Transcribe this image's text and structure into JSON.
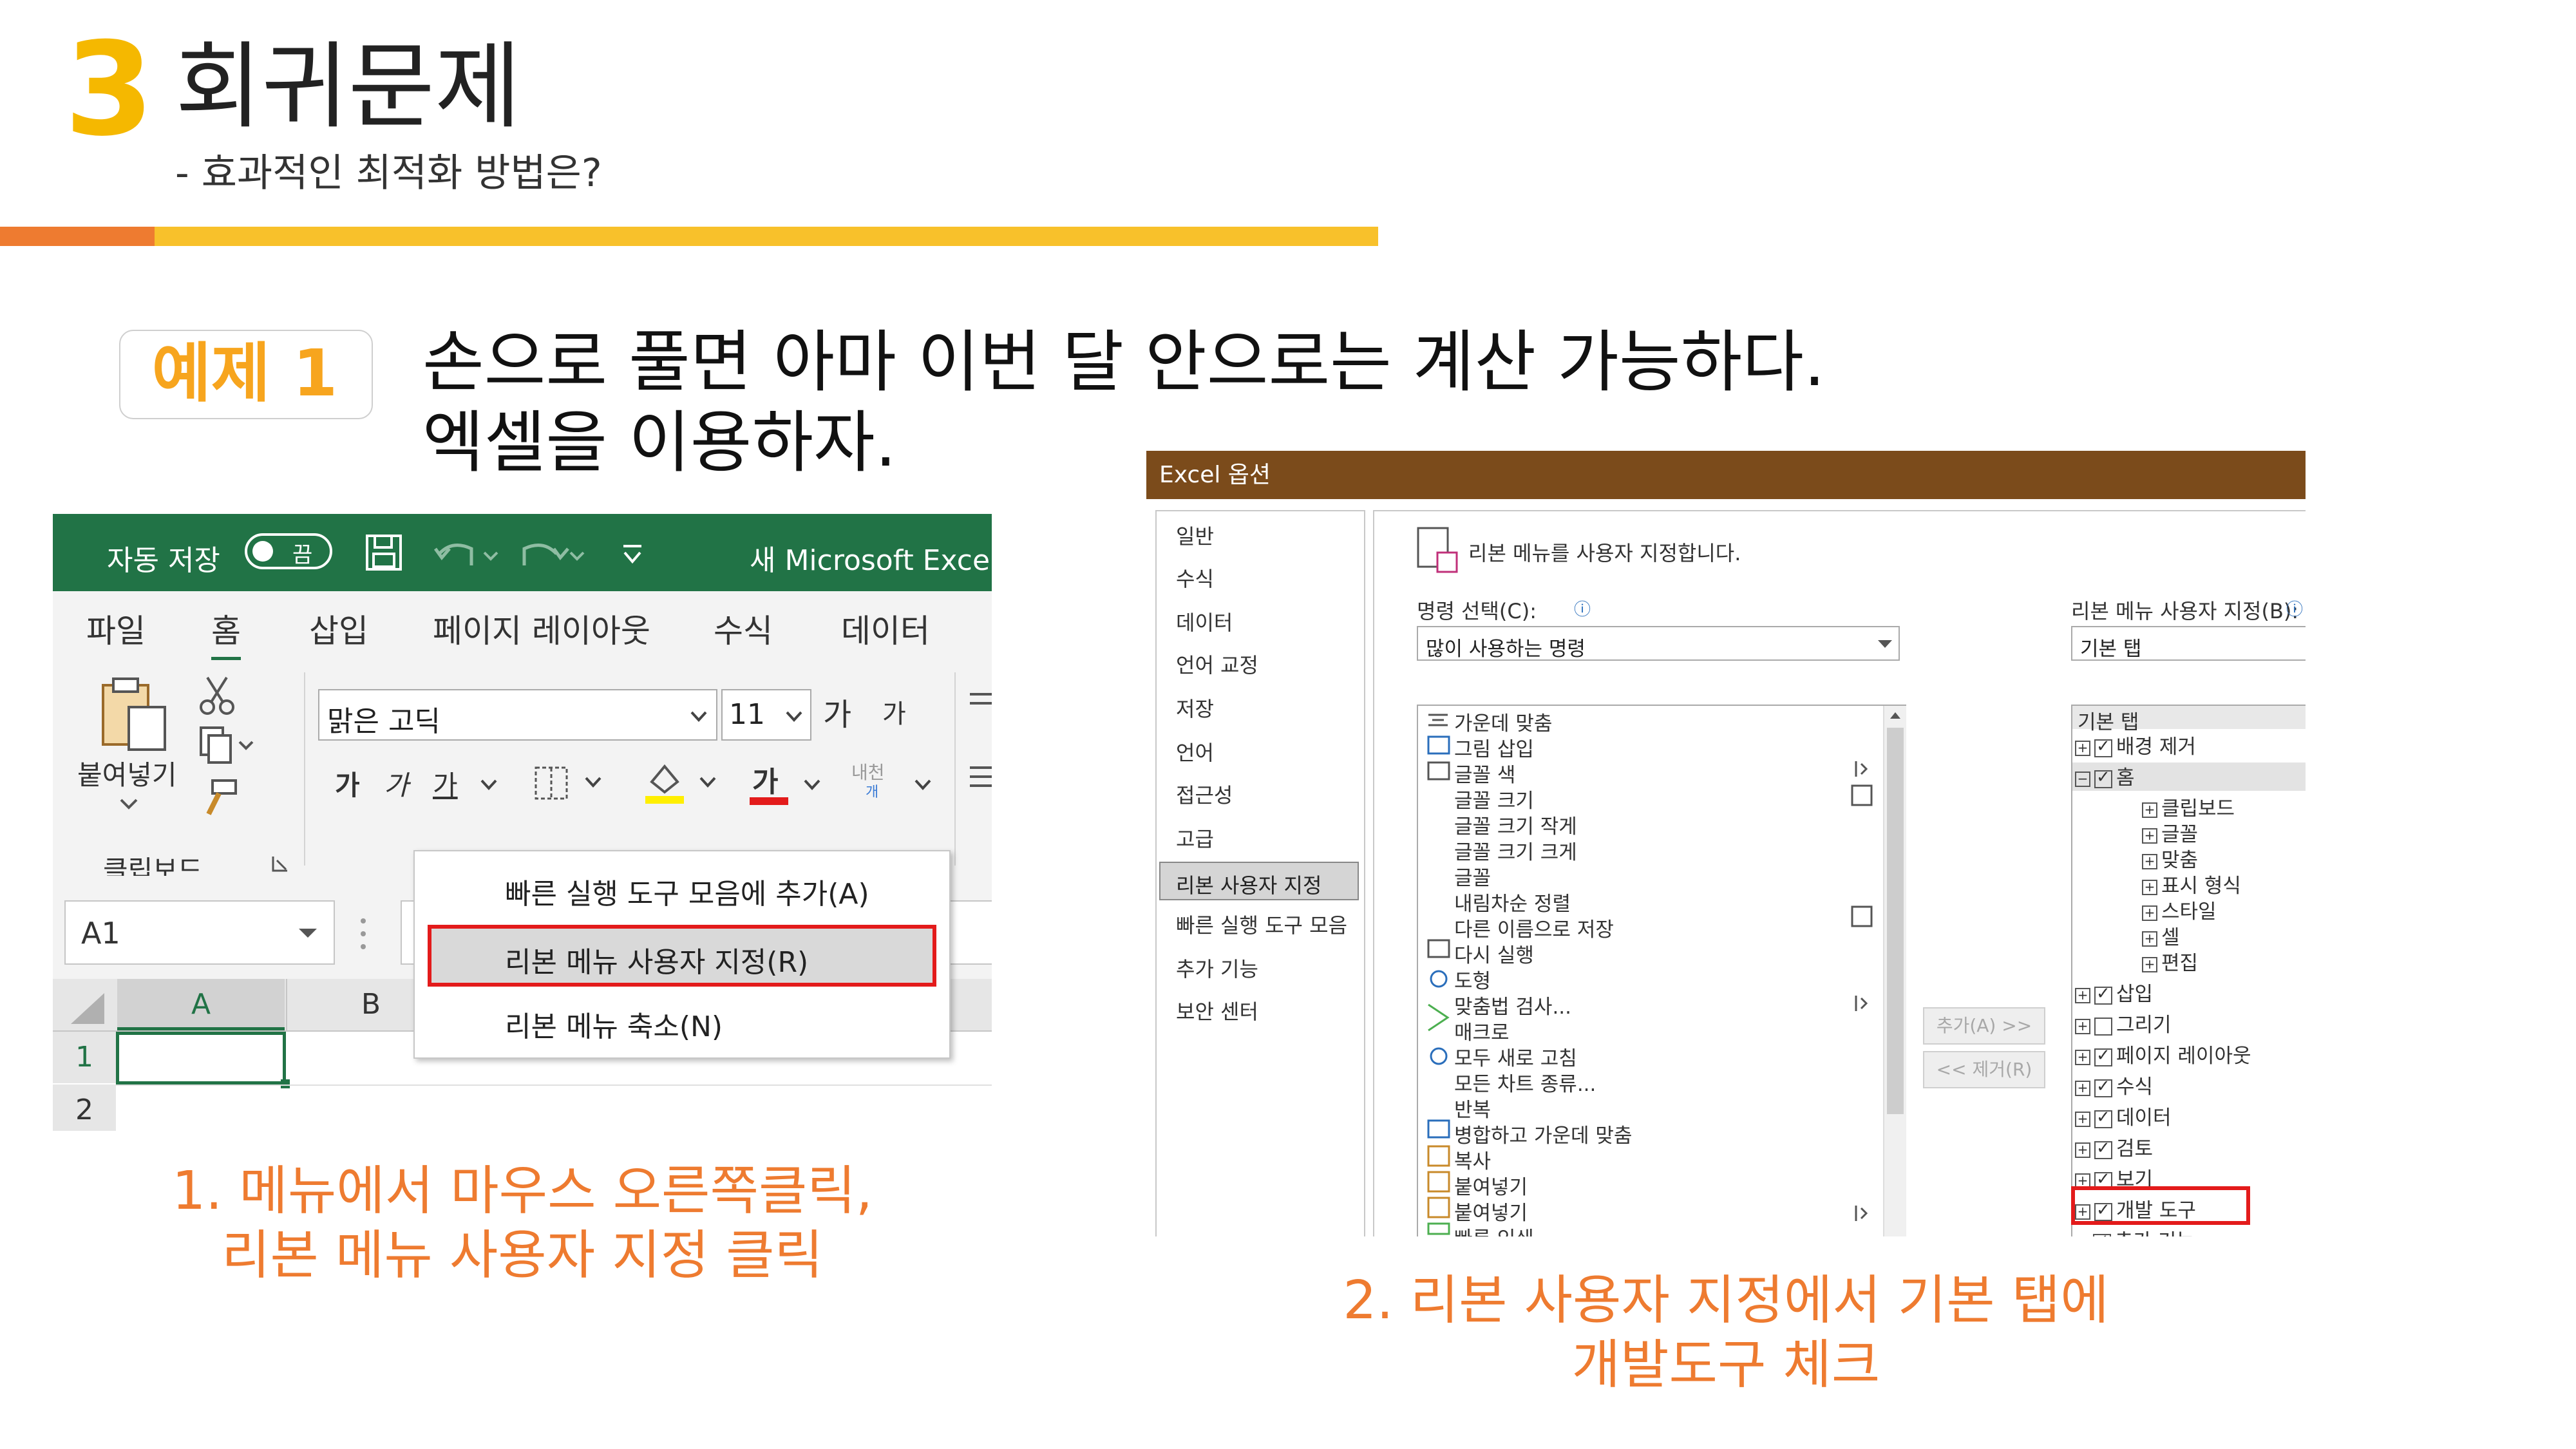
{
  "header": {
    "section_number": "3",
    "title": "회귀문제",
    "subtitle": "- 효과적인 최적화 방법은?"
  },
  "example": {
    "label": "예제 1",
    "line1": "손으로 풀면 아마 이번 달 안으로는 계산 가능하다.",
    "line2": "엑셀을 이용하자."
  },
  "excel": {
    "autosave_label": "자동 저장",
    "toggle_label": "끔",
    "window_title": "새 Microsoft Excel 워",
    "tabs": [
      "파일",
      "홈",
      "삽입",
      "페이지 레이아웃",
      "수식",
      "데이터"
    ],
    "paste_label": "붙여넣기",
    "clipboard_label": "클립보드",
    "font_name": "맑은 고딕",
    "font_size": "11",
    "grow_font": "가",
    "shrink_font": "가",
    "bold": "가",
    "italic": "가",
    "underline": "가",
    "font_color_glyph": "가",
    "phonetic": "내천",
    "phonetic_sub": "개",
    "name_box": "A1",
    "col_a": "A",
    "col_b": "B",
    "row_1": "1",
    "row_2": "2",
    "context_menu": [
      "빠른 실행 도구 모음에 추가(A)",
      "리본 메뉴 사용자 지정(R)",
      "리본 메뉴 축소(N)"
    ],
    "highlight_color": "#e31b1b",
    "title_bar_color": "#217346"
  },
  "caption1": {
    "line1": "1. 메뉴에서 마우스 오른쪽클릭,",
    "line2": "리본 메뉴 사용자 지정 클릭"
  },
  "options_dialog": {
    "title": "Excel 옵션",
    "sidebar": [
      "일반",
      "수식",
      "데이터",
      "언어 교정",
      "저장",
      "언어",
      "접근성",
      "고급",
      "리본 사용자 지정",
      "빠른 실행 도구 모음",
      "추가 기능",
      "보안 센터"
    ],
    "selected_sidebar": "리본 사용자 지정",
    "heading": "리본 메뉴를 사용자 지정합니다.",
    "choose_commands_label": "명령 선택(C):",
    "choose_commands_value": "많이 사용하는 명령",
    "customize_label": "리본 메뉴 사용자 지정(B):",
    "customize_value": "기본 탭",
    "commands": [
      "가운데 맞춤",
      "그림 삽입",
      "글꼴 색",
      "글꼴 크기",
      "글꼴 크기 작게",
      "글꼴 크기 크게",
      "글꼴",
      "내림차순 정렬",
      "다른 이름으로 저장",
      "다시 실행",
      "도형",
      "맞춤법 검사...",
      "매크로",
      "모두 새로 고침",
      "모든 차트 종류...",
      "반복",
      "병합하고 가운데 맞춤",
      "복사",
      "붙여넣기",
      "붙여넣기",
      "빠른 인쇄"
    ],
    "add_button": "추가(A) >>",
    "remove_button": "<< 제거(R)",
    "tree_header": "기본 탭",
    "tree": [
      {
        "label": "배경 제거",
        "level": 0,
        "checked": true
      },
      {
        "label": "홈",
        "level": 0,
        "checked": true,
        "expanded": true
      },
      {
        "label": "클립보드",
        "level": 1
      },
      {
        "label": "글꼴",
        "level": 1
      },
      {
        "label": "맞춤",
        "level": 1
      },
      {
        "label": "표시 형식",
        "level": 1
      },
      {
        "label": "스타일",
        "level": 1
      },
      {
        "label": "셀",
        "level": 1
      },
      {
        "label": "편집",
        "level": 1
      },
      {
        "label": "삽입",
        "level": 0,
        "checked": true
      },
      {
        "label": "그리기",
        "level": 0,
        "checked": false
      },
      {
        "label": "페이지 레이아웃",
        "level": 0,
        "checked": true
      },
      {
        "label": "수식",
        "level": 0,
        "checked": true
      },
      {
        "label": "데이터",
        "level": 0,
        "checked": true
      },
      {
        "label": "검토",
        "level": 0,
        "checked": true
      },
      {
        "label": "보기",
        "level": 0,
        "checked": true
      },
      {
        "label": "개발 도구",
        "level": 0,
        "checked": true
      },
      {
        "label": "추가 기능",
        "level": 0,
        "checked": true
      }
    ],
    "title_bar_color": "#7b4b1b"
  },
  "caption2": {
    "line1": "2. 리본 사용자 지정에서 기본 탭에",
    "line2": "개발도구 체크"
  },
  "colors": {
    "accent_yellow": "#f5b800",
    "accent_orange": "#ee7b30",
    "highlight_red": "#e31b1b"
  }
}
